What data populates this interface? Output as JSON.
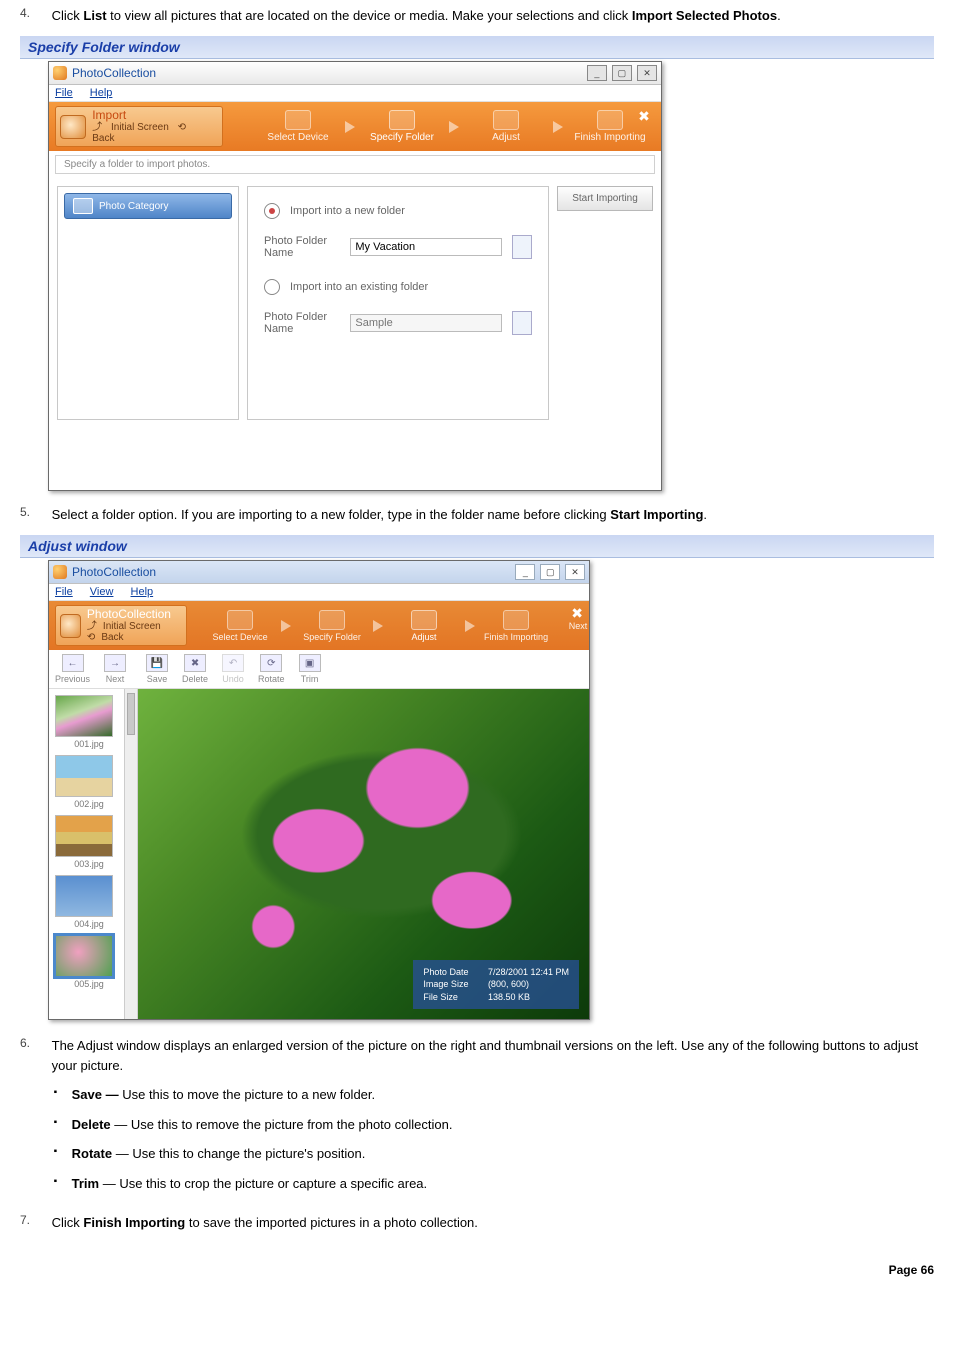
{
  "page_number": "Page 66",
  "steps": {
    "s4": {
      "num": "4.",
      "pre": "Click ",
      "b1": "List",
      "mid": " to view all pictures that are located on the device or media. Make your selections and click ",
      "b2": "Import Selected Photos",
      "post": "."
    },
    "s5": {
      "num": "5.",
      "pre": "Select a folder option. If you are importing to a new folder, type in the folder name before clicking ",
      "b1": "Start Importing",
      "post": "."
    },
    "s6": {
      "num": "6.",
      "text": "The Adjust window displays an enlarged version of the picture on the right and thumbnail versions on the left. Use any of the following buttons to adjust your picture."
    },
    "s7": {
      "num": "7.",
      "pre": "Click ",
      "b1": "Finish Importing",
      "post": " to save the imported pictures in a photo collection."
    }
  },
  "bullets": {
    "save": {
      "b": "Save — ",
      "t": "Use this to move the picture to a new folder."
    },
    "delete": {
      "b": "Delete",
      "dash": " — ",
      "t": "Use this to remove the picture from the photo collection."
    },
    "rotate": {
      "b": "Rotate",
      "dash": " — ",
      "t": "Use this to change the picture's position."
    },
    "trim": {
      "b": "Trim",
      "dash": " — ",
      "t": "Use this to crop the picture or capture a specific area."
    }
  },
  "caption1": "Specify Folder window",
  "caption2": "Adjust window",
  "shot1": {
    "title": "PhotoCollection",
    "menu_file": "File",
    "menu_help": "Help",
    "import_label": "Import",
    "initial_screen": "Initial Screen",
    "back": "Back",
    "chain": {
      "select_device": "Select Device",
      "specify_folder": "Specify Folder",
      "adjust": "Adjust",
      "finish_importing": "Finish Importing"
    },
    "hint": "Specify a folder to import photos.",
    "photo_category": "Photo Category",
    "radio_new": "Import into a new folder",
    "radio_existing": "Import into an existing folder",
    "label_folder_name": "Photo Folder Name",
    "new_folder_value": "My Vacation",
    "existing_placeholder": "Sample",
    "start_importing": "Start Importing"
  },
  "shot2": {
    "title": "PhotoCollection",
    "menu_file": "File",
    "menu_view": "View",
    "menu_help": "Help",
    "import_label": "PhotoCollection",
    "initial_screen": "Initial Screen",
    "back": "Back",
    "chain": {
      "select_device": "Select Device",
      "specify_folder": "Specify Folder",
      "adjust": "Adjust",
      "finish_importing": "Finish Importing",
      "next": "Next"
    },
    "toolbar_l": {
      "previous": "Previous",
      "next": "Next"
    },
    "toolbar_r": {
      "save": "Save",
      "delete": "Delete",
      "undo": "Undo",
      "rotate": "Rotate",
      "trim": "Trim"
    },
    "thumbs": [
      "001.jpg",
      "002.jpg",
      "003.jpg",
      "004.jpg",
      "005.jpg"
    ],
    "info": {
      "date_l": "Photo Date",
      "date_v": "7/28/2001 12:41 PM",
      "size_l": "Image Size",
      "size_v": "(800, 600)",
      "file_l": "File Size",
      "file_v": "138.50 KB"
    }
  }
}
